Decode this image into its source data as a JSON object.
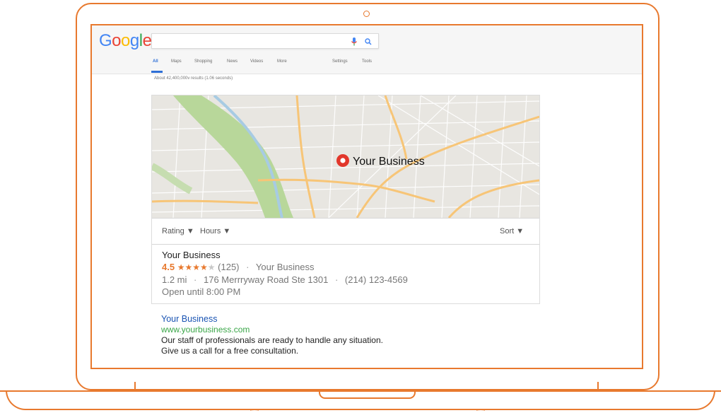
{
  "colors": {
    "accent_orange": "#e8792e",
    "link_blue": "#1a54b3",
    "url_green": "#3aa648",
    "pin_red": "#e2372b"
  },
  "header": {
    "logo_letters": [
      {
        "ch": "G",
        "color": "#4285f4"
      },
      {
        "ch": "o",
        "color": "#ea4335"
      },
      {
        "ch": "o",
        "color": "#fbbc05"
      },
      {
        "ch": "g",
        "color": "#4285f4"
      },
      {
        "ch": "l",
        "color": "#34a853"
      },
      {
        "ch": "e",
        "color": "#ea4335"
      }
    ],
    "search_value": "",
    "mic_icon": "microphone-icon",
    "search_icon": "magnifier-icon"
  },
  "tabs": [
    "All",
    "Maps",
    "Shopping",
    "News",
    "Videos",
    "More",
    "Settings",
    "Tools"
  ],
  "results_count": "About 42,400,000v results (1.06 seconds)",
  "map": {
    "pin_label": "Your Business"
  },
  "filters": {
    "rating": "Rating ▼",
    "hours": "Hours ▼",
    "sort": "Sort ▼"
  },
  "local_listing": {
    "name": "Your Business",
    "rating": "4.5",
    "stars_full": 4,
    "stars_total": 5,
    "reviews": "(125)",
    "category": "Your Business",
    "distance": "1.2 mi",
    "address": "176 Merrryway Road Ste 1301",
    "phone": "(214) 123-4569",
    "hours": "Open until 8:00 PM"
  },
  "organic": {
    "title": "Your Business",
    "url": "www.yourbusiness.com",
    "desc_line1": "Our staff of professionals are ready to handle any situation.",
    "desc_line2": "Give us a call for a free consultation."
  }
}
